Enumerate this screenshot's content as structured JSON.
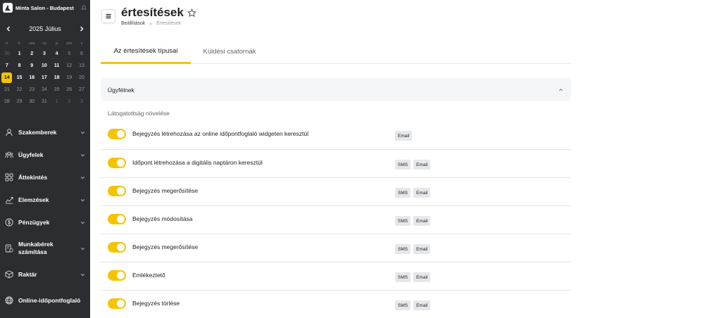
{
  "salon": {
    "name": "Minta Salon - Budapest"
  },
  "calendar": {
    "title": "2025 Július",
    "weekdays": [
      "h",
      "k",
      "sze",
      "cs",
      "p",
      "szo",
      "v"
    ],
    "weeks": [
      [
        {
          "d": "30",
          "s": "muted"
        },
        {
          "d": "1",
          "s": "cur"
        },
        {
          "d": "2",
          "s": "cur"
        },
        {
          "d": "3",
          "s": "cur"
        },
        {
          "d": "4",
          "s": "cur"
        },
        {
          "d": "5",
          "s": "dim"
        },
        {
          "d": "6",
          "s": "dim"
        }
      ],
      [
        {
          "d": "7",
          "s": "cur"
        },
        {
          "d": "8",
          "s": "cur"
        },
        {
          "d": "9",
          "s": "cur"
        },
        {
          "d": "10",
          "s": "cur"
        },
        {
          "d": "11",
          "s": "cur"
        },
        {
          "d": "12",
          "s": "dim"
        },
        {
          "d": "13",
          "s": "dim"
        }
      ],
      [
        {
          "d": "14",
          "s": "today"
        },
        {
          "d": "15",
          "s": "cur"
        },
        {
          "d": "16",
          "s": "cur"
        },
        {
          "d": "17",
          "s": "cur"
        },
        {
          "d": "18",
          "s": "cur"
        },
        {
          "d": "19",
          "s": "dim"
        },
        {
          "d": "20",
          "s": "dim"
        }
      ],
      [
        {
          "d": "21",
          "s": "dim"
        },
        {
          "d": "22",
          "s": "dim"
        },
        {
          "d": "23",
          "s": "dim"
        },
        {
          "d": "24",
          "s": "dim"
        },
        {
          "d": "25",
          "s": "dim"
        },
        {
          "d": "26",
          "s": "dim"
        },
        {
          "d": "27",
          "s": "dim"
        }
      ],
      [
        {
          "d": "28",
          "s": "dim"
        },
        {
          "d": "29",
          "s": "dim"
        },
        {
          "d": "30",
          "s": "dim"
        },
        {
          "d": "31",
          "s": "dim"
        },
        {
          "d": "1",
          "s": "muted"
        },
        {
          "d": "2",
          "s": "muted"
        },
        {
          "d": "3",
          "s": "muted"
        }
      ]
    ]
  },
  "nav": [
    {
      "label": "Szakemberek",
      "icon": "user-icon"
    },
    {
      "label": "Ügyfelek",
      "icon": "users-icon"
    },
    {
      "label": "Áttekintés",
      "icon": "grid-icon"
    },
    {
      "label": "Elemzések",
      "icon": "chart-icon"
    },
    {
      "label": "Pénzügyek",
      "icon": "coin-icon"
    },
    {
      "label": "Munkabérek számítása",
      "icon": "payroll-icon"
    },
    {
      "label": "Raktár",
      "icon": "box-icon"
    },
    {
      "label": "Online-időpontfoglaló",
      "icon": "globe-icon"
    }
  ],
  "header": {
    "title": "értesítések",
    "breadcrumb_parent": "Beállítások",
    "breadcrumb_current": "Értesítések"
  },
  "tabs": [
    {
      "label": "Az értesítések típusai",
      "active": true
    },
    {
      "label": "Küldési csatornák",
      "active": false
    }
  ],
  "section": {
    "title": "Ügyfélnek",
    "group_label": "Látogatottság növelése"
  },
  "rows": [
    {
      "label": "Bejegyzés létrehozása az online időpontfoglaló widgeten keresztül",
      "enabled": true,
      "channels": [
        "Email"
      ]
    },
    {
      "label": "Időpont létrehozása a digitális naptáron keresztül",
      "enabled": true,
      "channels": [
        "SMS",
        "Email"
      ]
    },
    {
      "label": "Bejegyzés megerősítése",
      "enabled": true,
      "channels": [
        "SMS",
        "Email"
      ]
    },
    {
      "label": "Bejegyzés módosítása",
      "enabled": true,
      "channels": [
        "SMS",
        "Email"
      ]
    },
    {
      "label": "Bejegyzés megerősítése",
      "enabled": true,
      "channels": [
        "SMS",
        "Email"
      ]
    },
    {
      "label": "Emlékeztető",
      "enabled": true,
      "channels": [
        "SMS",
        "Email"
      ]
    },
    {
      "label": "Bejegyzés törlése",
      "enabled": true,
      "channels": [
        "SMS",
        "Email"
      ]
    }
  ],
  "colors": {
    "accent": "#f5c400",
    "sidebar": "#2b2d31",
    "badge": "#e6e7ea"
  }
}
